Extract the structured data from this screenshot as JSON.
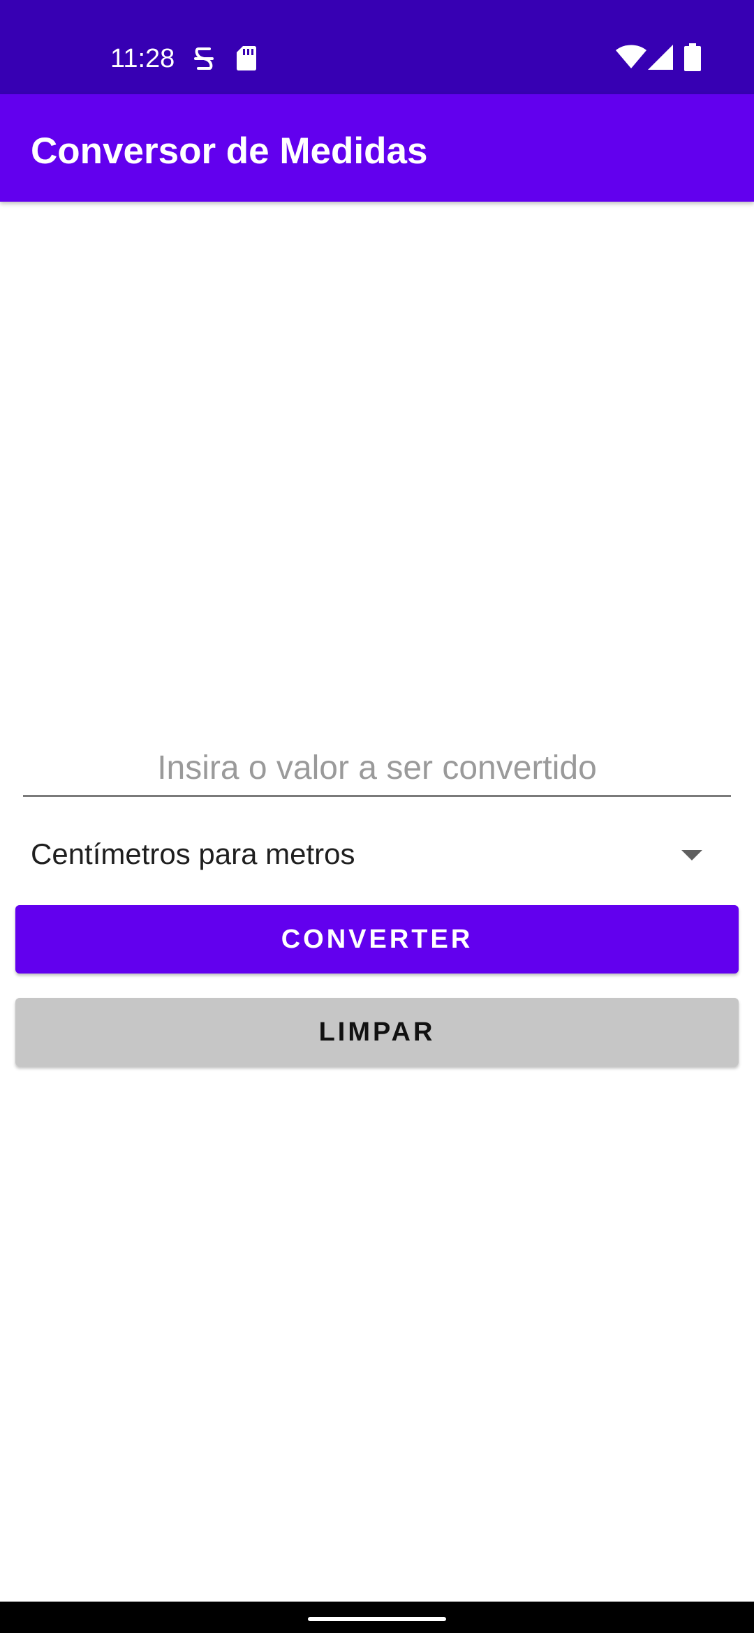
{
  "status_bar": {
    "time": "11:28",
    "icons": [
      "data-saver-icon",
      "sd-card-icon",
      "wifi-icon",
      "cell-signal-icon",
      "battery-icon"
    ],
    "background": "#3700b3"
  },
  "app_bar": {
    "title": "Conversor de Medidas",
    "background": "#6200ee"
  },
  "main": {
    "value_input": {
      "value": "",
      "placeholder": "Insira o valor a ser convertido"
    },
    "unit_spinner": {
      "selected": "Centímetros para metros"
    },
    "convert_button": {
      "label": "CONVERTER",
      "background": "#6200ee"
    },
    "clear_button": {
      "label": "LIMPAR",
      "background": "#c6c6c6"
    }
  }
}
